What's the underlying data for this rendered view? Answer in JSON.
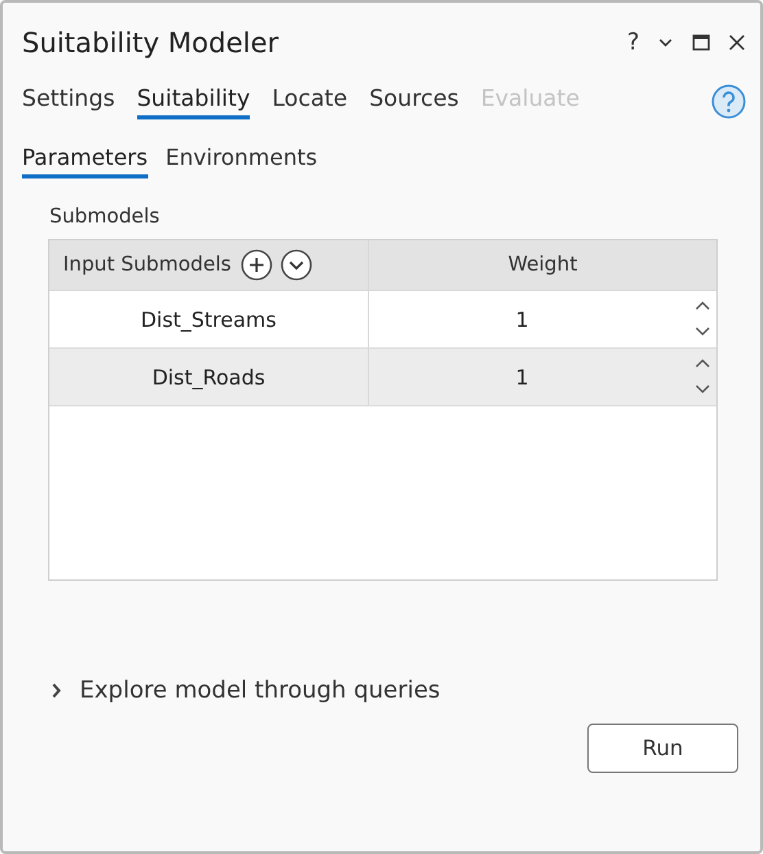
{
  "window": {
    "title": "Suitability Modeler",
    "buttons": [
      "?"
    ]
  },
  "tabs": [
    {
      "label": "Settings",
      "selected": false,
      "disabled": false
    },
    {
      "label": "Suitability",
      "selected": true,
      "disabled": false
    },
    {
      "label": "Locate",
      "selected": false,
      "disabled": false
    },
    {
      "label": "Sources",
      "selected": false,
      "disabled": false
    },
    {
      "label": "Evaluate",
      "selected": false,
      "disabled": true
    }
  ],
  "subtabs": [
    {
      "label": "Parameters",
      "selected": true
    },
    {
      "label": "Environments",
      "selected": false
    }
  ],
  "section_label": "Submodels",
  "table": {
    "columns": [
      "Input Submodels",
      "Weight"
    ],
    "rows": [
      {
        "name": "Dist_Streams",
        "weight": "1"
      },
      {
        "name": "Dist_Roads",
        "weight": "1"
      }
    ]
  },
  "expander": {
    "label": "Explore model through queries",
    "expanded": false
  },
  "run_button": "Run"
}
